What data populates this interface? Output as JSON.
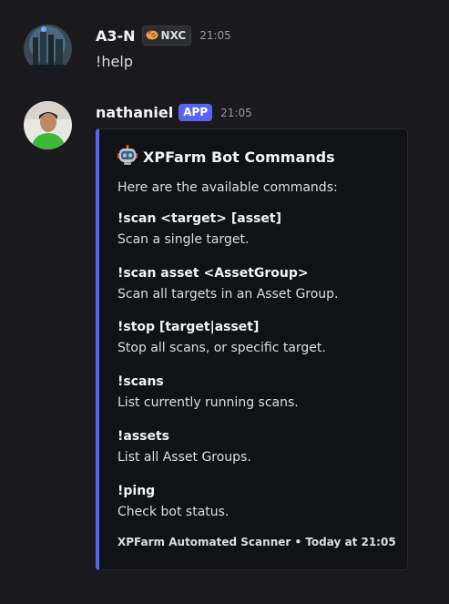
{
  "messages": [
    {
      "author": "A3-N",
      "tag": "NXC",
      "time": "21:05",
      "content": "!help"
    },
    {
      "author": "nathaniel",
      "badge": "APP",
      "time": "21:05",
      "embed": {
        "title": "XPFarm Bot Commands",
        "description": "Here are the available commands:",
        "fields": [
          {
            "name": "!scan <target> [asset]",
            "value": "Scan a single target."
          },
          {
            "name": "!scan asset <AssetGroup>",
            "value": "Scan all targets in an Asset Group."
          },
          {
            "name": "!stop [target|asset]",
            "value": "Stop all scans, or specific target."
          },
          {
            "name": "!scans",
            "value": "List currently running scans."
          },
          {
            "name": "!assets",
            "value": "List all Asset Groups."
          },
          {
            "name": "!ping",
            "value": "Check bot status."
          }
        ],
        "footer": "XPFarm Automated Scanner • Today at 21:05",
        "accent_color": "#5865f2"
      }
    }
  ],
  "icons": {
    "tag_icon": "bread-icon",
    "title_icon": "robot-icon"
  }
}
